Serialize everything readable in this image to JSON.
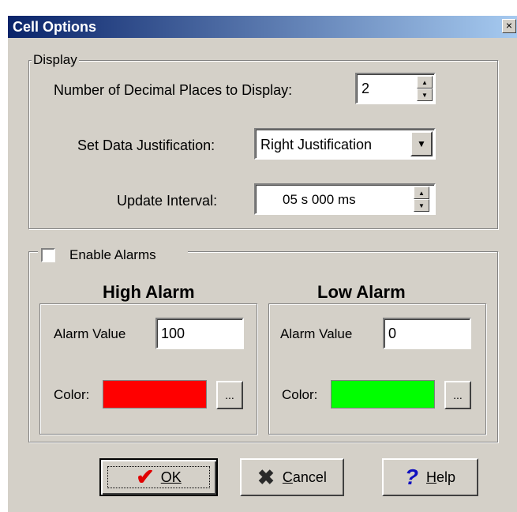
{
  "window": {
    "title": "Cell Options",
    "close_glyph": "×"
  },
  "display": {
    "legend": "Display",
    "decimal_label": "Number of Decimal Places to Display:",
    "decimal_value": "2",
    "justification_label": "Set Data Justification:",
    "justification_value": "Right Justification",
    "interval_label": "Update Interval:",
    "interval_value": "05 s 000 ms"
  },
  "alarms": {
    "enable_label": "Enable Alarms",
    "enabled": false,
    "high": {
      "title": "High Alarm",
      "value_label": "Alarm Value",
      "value": "100",
      "color_label": "Color:",
      "color": "#ff0000",
      "browse_label": "..."
    },
    "low": {
      "title": "Low Alarm",
      "value_label": "Alarm Value",
      "value": "0",
      "color_label": "Color:",
      "color": "#00ff00",
      "browse_label": "..."
    }
  },
  "buttons": {
    "ok": {
      "label": "OK",
      "icon": "checkmark-icon"
    },
    "cancel": {
      "label": "Cancel",
      "icon": "x-icon"
    },
    "help": {
      "label": "Help",
      "icon": "question-icon"
    }
  },
  "colors": {
    "face": "#d4d0c8",
    "title_start": "#0a246a",
    "title_end": "#a6caf0",
    "check_red": "#e00000",
    "x_dark": "#2a2a2a",
    "help_blue": "#1010c0"
  }
}
